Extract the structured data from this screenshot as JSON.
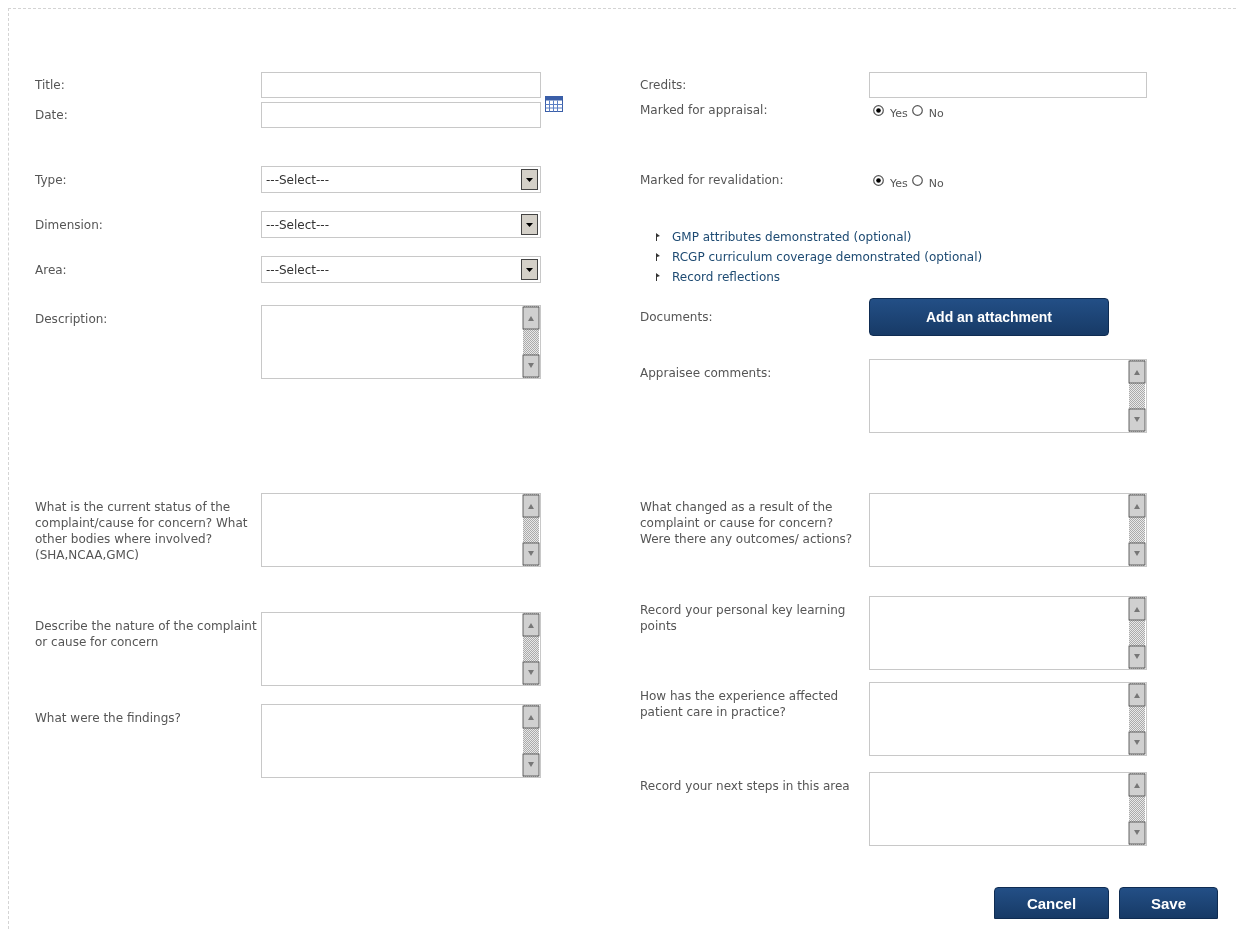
{
  "left_top": [
    {
      "kind": "text",
      "label": "Title:"
    },
    {
      "kind": "date",
      "label": "Date:"
    },
    {
      "kind": "select",
      "label": "Type:",
      "value": "---Select---"
    },
    {
      "kind": "select",
      "label": "Dimension:",
      "value": "---Select---"
    },
    {
      "kind": "select",
      "label": "Area:",
      "value": "---Select---"
    },
    {
      "kind": "textarea",
      "label": "Description:"
    }
  ],
  "right_top": [
    {
      "kind": "text",
      "label": "Credits:"
    },
    {
      "kind": "radio",
      "label": "Marked for appraisal:",
      "options": [
        {
          "label": "Yes",
          "selected": true
        },
        {
          "label": "No",
          "selected": false
        }
      ]
    },
    {
      "kind": "radio",
      "label": "Marked for revalidation:",
      "options": [
        {
          "label": "Yes",
          "selected": true
        },
        {
          "label": "No",
          "selected": false
        }
      ]
    },
    {
      "kind": "links",
      "items": [
        "GMP attributes demonstrated (optional)",
        "RCGP curriculum coverage demonstrated (optional)",
        "Record reflections"
      ]
    },
    {
      "kind": "button",
      "label": "Documents:",
      "button": "Add an attachment"
    },
    {
      "kind": "textarea",
      "label": "Appraisee comments:"
    }
  ],
  "left_bottom": [
    {
      "kind": "textarea",
      "label": "What is the current status of the complaint/cause for concern? What other bodies where involved? (SHA,NCAA,GMC)"
    },
    {
      "kind": "textarea",
      "label": "Describe the nature of the complaint or cause for concern"
    },
    {
      "kind": "textarea",
      "label": "What were the findings?"
    }
  ],
  "right_bottom": [
    {
      "kind": "textarea",
      "label": "What changed as a result of the complaint or cause for concern? Were there any outcomes/ actions?"
    },
    {
      "kind": "textarea",
      "label": "Record your personal key learning points"
    },
    {
      "kind": "textarea",
      "label": "How has the experience affected patient care in practice?"
    },
    {
      "kind": "textarea",
      "label": "Record your next steps in this area"
    }
  ],
  "buttons": [
    "Cancel",
    "Save"
  ]
}
